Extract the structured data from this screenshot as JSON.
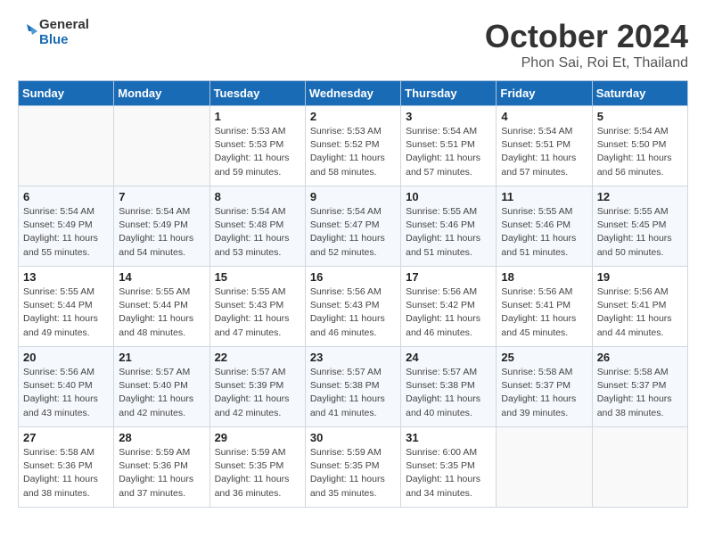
{
  "header": {
    "logo_line1": "General",
    "logo_line2": "Blue",
    "month_title": "October 2024",
    "subtitle": "Phon Sai, Roi Et, Thailand"
  },
  "days_of_week": [
    "Sunday",
    "Monday",
    "Tuesday",
    "Wednesday",
    "Thursday",
    "Friday",
    "Saturday"
  ],
  "weeks": [
    [
      {
        "day": "",
        "info": ""
      },
      {
        "day": "",
        "info": ""
      },
      {
        "day": "1",
        "info": "Sunrise: 5:53 AM\nSunset: 5:53 PM\nDaylight: 11 hours and 59 minutes."
      },
      {
        "day": "2",
        "info": "Sunrise: 5:53 AM\nSunset: 5:52 PM\nDaylight: 11 hours and 58 minutes."
      },
      {
        "day": "3",
        "info": "Sunrise: 5:54 AM\nSunset: 5:51 PM\nDaylight: 11 hours and 57 minutes."
      },
      {
        "day": "4",
        "info": "Sunrise: 5:54 AM\nSunset: 5:51 PM\nDaylight: 11 hours and 57 minutes."
      },
      {
        "day": "5",
        "info": "Sunrise: 5:54 AM\nSunset: 5:50 PM\nDaylight: 11 hours and 56 minutes."
      }
    ],
    [
      {
        "day": "6",
        "info": "Sunrise: 5:54 AM\nSunset: 5:49 PM\nDaylight: 11 hours and 55 minutes."
      },
      {
        "day": "7",
        "info": "Sunrise: 5:54 AM\nSunset: 5:49 PM\nDaylight: 11 hours and 54 minutes."
      },
      {
        "day": "8",
        "info": "Sunrise: 5:54 AM\nSunset: 5:48 PM\nDaylight: 11 hours and 53 minutes."
      },
      {
        "day": "9",
        "info": "Sunrise: 5:54 AM\nSunset: 5:47 PM\nDaylight: 11 hours and 52 minutes."
      },
      {
        "day": "10",
        "info": "Sunrise: 5:55 AM\nSunset: 5:46 PM\nDaylight: 11 hours and 51 minutes."
      },
      {
        "day": "11",
        "info": "Sunrise: 5:55 AM\nSunset: 5:46 PM\nDaylight: 11 hours and 51 minutes."
      },
      {
        "day": "12",
        "info": "Sunrise: 5:55 AM\nSunset: 5:45 PM\nDaylight: 11 hours and 50 minutes."
      }
    ],
    [
      {
        "day": "13",
        "info": "Sunrise: 5:55 AM\nSunset: 5:44 PM\nDaylight: 11 hours and 49 minutes."
      },
      {
        "day": "14",
        "info": "Sunrise: 5:55 AM\nSunset: 5:44 PM\nDaylight: 11 hours and 48 minutes."
      },
      {
        "day": "15",
        "info": "Sunrise: 5:55 AM\nSunset: 5:43 PM\nDaylight: 11 hours and 47 minutes."
      },
      {
        "day": "16",
        "info": "Sunrise: 5:56 AM\nSunset: 5:43 PM\nDaylight: 11 hours and 46 minutes."
      },
      {
        "day": "17",
        "info": "Sunrise: 5:56 AM\nSunset: 5:42 PM\nDaylight: 11 hours and 46 minutes."
      },
      {
        "day": "18",
        "info": "Sunrise: 5:56 AM\nSunset: 5:41 PM\nDaylight: 11 hours and 45 minutes."
      },
      {
        "day": "19",
        "info": "Sunrise: 5:56 AM\nSunset: 5:41 PM\nDaylight: 11 hours and 44 minutes."
      }
    ],
    [
      {
        "day": "20",
        "info": "Sunrise: 5:56 AM\nSunset: 5:40 PM\nDaylight: 11 hours and 43 minutes."
      },
      {
        "day": "21",
        "info": "Sunrise: 5:57 AM\nSunset: 5:40 PM\nDaylight: 11 hours and 42 minutes."
      },
      {
        "day": "22",
        "info": "Sunrise: 5:57 AM\nSunset: 5:39 PM\nDaylight: 11 hours and 42 minutes."
      },
      {
        "day": "23",
        "info": "Sunrise: 5:57 AM\nSunset: 5:38 PM\nDaylight: 11 hours and 41 minutes."
      },
      {
        "day": "24",
        "info": "Sunrise: 5:57 AM\nSunset: 5:38 PM\nDaylight: 11 hours and 40 minutes."
      },
      {
        "day": "25",
        "info": "Sunrise: 5:58 AM\nSunset: 5:37 PM\nDaylight: 11 hours and 39 minutes."
      },
      {
        "day": "26",
        "info": "Sunrise: 5:58 AM\nSunset: 5:37 PM\nDaylight: 11 hours and 38 minutes."
      }
    ],
    [
      {
        "day": "27",
        "info": "Sunrise: 5:58 AM\nSunset: 5:36 PM\nDaylight: 11 hours and 38 minutes."
      },
      {
        "day": "28",
        "info": "Sunrise: 5:59 AM\nSunset: 5:36 PM\nDaylight: 11 hours and 37 minutes."
      },
      {
        "day": "29",
        "info": "Sunrise: 5:59 AM\nSunset: 5:35 PM\nDaylight: 11 hours and 36 minutes."
      },
      {
        "day": "30",
        "info": "Sunrise: 5:59 AM\nSunset: 5:35 PM\nDaylight: 11 hours and 35 minutes."
      },
      {
        "day": "31",
        "info": "Sunrise: 6:00 AM\nSunset: 5:35 PM\nDaylight: 11 hours and 34 minutes."
      },
      {
        "day": "",
        "info": ""
      },
      {
        "day": "",
        "info": ""
      }
    ]
  ]
}
